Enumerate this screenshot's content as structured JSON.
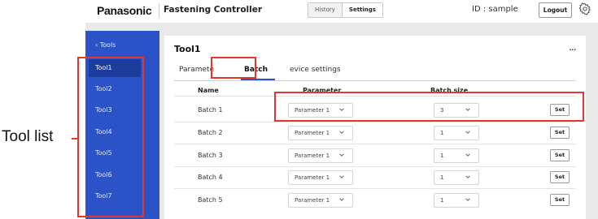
{
  "header": {
    "logo": "Panasonic",
    "app_title": "Fastening Controller",
    "nav": [
      "History",
      "Settings"
    ],
    "user_id": "ID : sample",
    "logout_label": "Logout",
    "icons": {
      "settings": "gear-icon"
    }
  },
  "sidebar": {
    "back_label": "Tools",
    "items": [
      {
        "label": "Tool1",
        "active": true
      },
      {
        "label": "Tool2",
        "active": false
      },
      {
        "label": "Tool3",
        "active": false
      },
      {
        "label": "Tool4",
        "active": false
      },
      {
        "label": "Tool5",
        "active": false
      },
      {
        "label": "Tool6",
        "active": false
      },
      {
        "label": "Tool7",
        "active": false
      }
    ]
  },
  "main": {
    "title": "Tool1",
    "more_label": "...",
    "tabs": [
      {
        "label": "Paramete",
        "active": false
      },
      {
        "label": "Batch",
        "active": true
      },
      {
        "label": "evice settings",
        "active": false
      }
    ],
    "columns": [
      "Name",
      "Parameter",
      "Batch size"
    ],
    "rows": [
      {
        "name": "Batch 1",
        "parameter": "Parameter 1",
        "batch_size": "3",
        "set_label": "Set"
      },
      {
        "name": "Batch 2",
        "parameter": "Parameter 1",
        "batch_size": "1",
        "set_label": "Set"
      },
      {
        "name": "Batch 3",
        "parameter": "Parameter 1",
        "batch_size": "1",
        "set_label": "Set"
      },
      {
        "name": "Batch 4",
        "parameter": "Parameter 1",
        "batch_size": "1",
        "set_label": "Set"
      },
      {
        "name": "Batch 5",
        "parameter": "Parameter 1",
        "batch_size": "1",
        "set_label": "Set"
      }
    ]
  },
  "annotation": {
    "label": "Tool list",
    "color": "#e2382b"
  },
  "colors": {
    "accent": "#2b52c7",
    "sidebar_active": "#1c3c9e"
  }
}
